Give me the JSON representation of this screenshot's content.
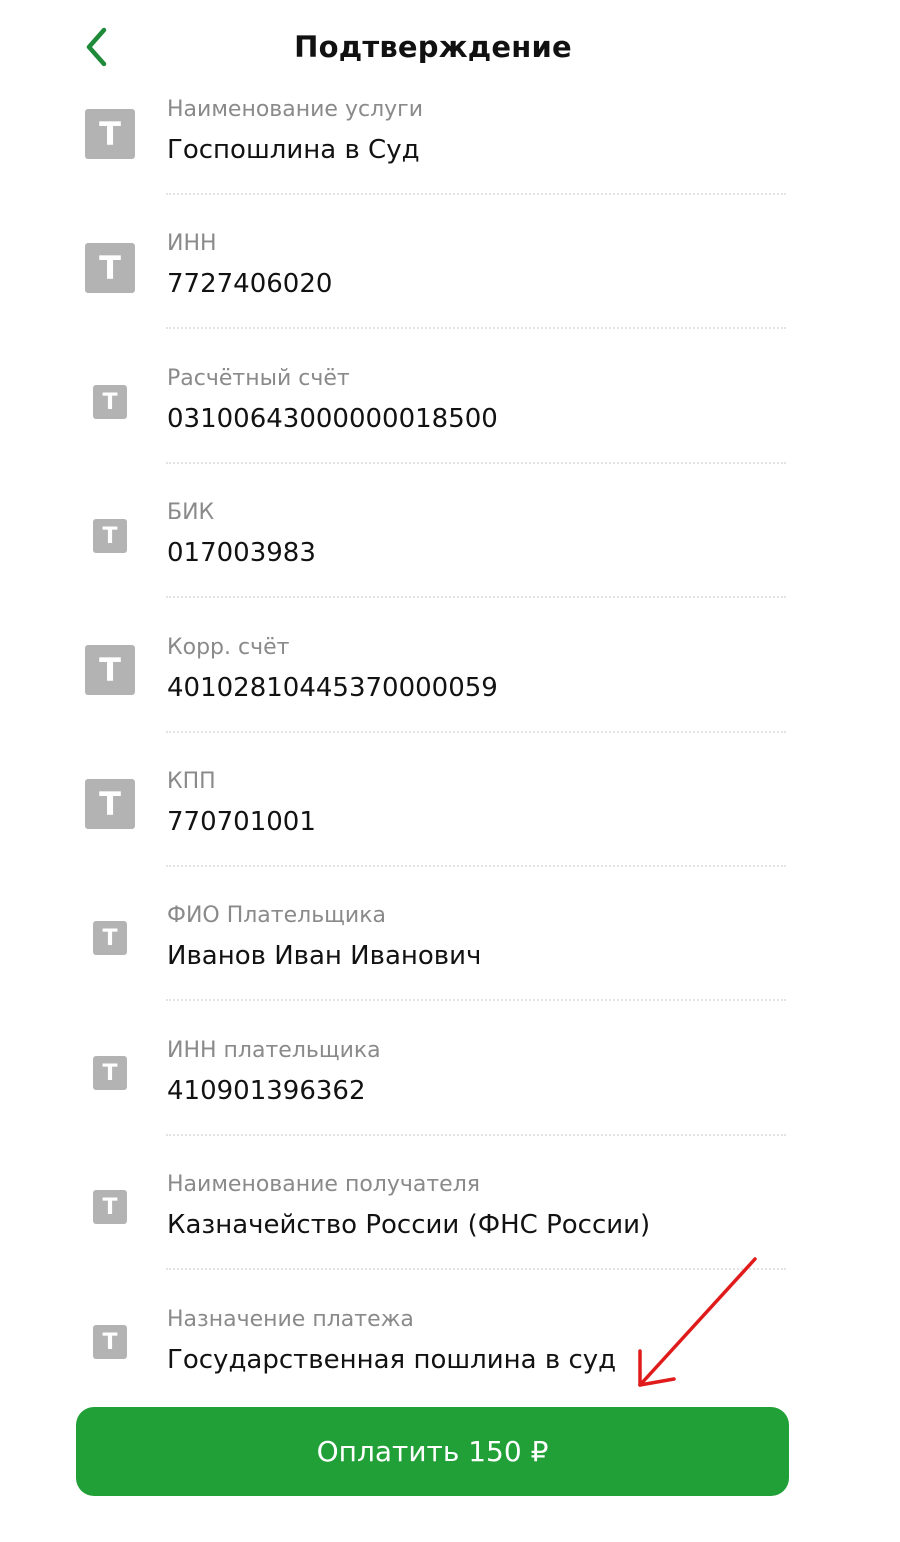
{
  "header": {
    "title": "Подтверждение",
    "back_icon": "chevron-left-icon",
    "accent_color": "#1f8a3a"
  },
  "fields": [
    {
      "icon": "T",
      "label": "Наименование услуги",
      "value": "Госпошлина в Суд"
    },
    {
      "icon": "T",
      "label": "ИНН",
      "value": "7727406020"
    },
    {
      "icon": "T",
      "label": "Расчётный счёт",
      "value": "03100643000000018500"
    },
    {
      "icon": "T",
      "label": "БИК",
      "value": "017003983"
    },
    {
      "icon": "T",
      "label": "Корр. счёт",
      "value": "40102810445370000059"
    },
    {
      "icon": "T",
      "label": "КПП",
      "value": "770701001"
    },
    {
      "icon": "T",
      "label": "ФИО Плательщика",
      "value": "Иванов Иван Иванович"
    },
    {
      "icon": "T",
      "label": "ИНН плательщика",
      "value": "410901396362"
    },
    {
      "icon": "T",
      "label": "Наименование получателя",
      "value": "Казначейство России (ФНС России)"
    },
    {
      "icon": "T",
      "label": "Назначение платежа",
      "value": "Государственная пошлина в суд"
    }
  ],
  "pay_button": {
    "label": "Оплатить 150 ₽",
    "color": "#21a038"
  },
  "annotation": {
    "arrow_color": "#e01b1b"
  }
}
